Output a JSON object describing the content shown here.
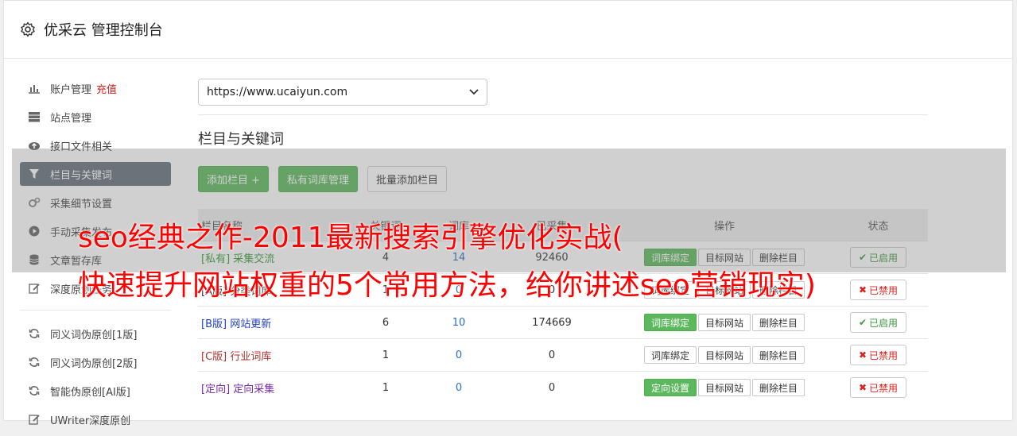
{
  "header": {
    "title": "优采云 管理控制台"
  },
  "sidebar": {
    "items": [
      {
        "label": "账户管理",
        "badge": "充值",
        "icon": "bar-chart-icon"
      },
      {
        "label": "站点管理",
        "icon": "server-icon"
      },
      {
        "label": "接口文件相关",
        "icon": "cloud-upload-icon"
      },
      {
        "label": "栏目与关键词",
        "icon": "filter-icon",
        "active": true
      },
      {
        "label": "采集细节设置",
        "icon": "gears-icon"
      },
      {
        "label": "手动采集发布",
        "icon": "play-circle-icon"
      },
      {
        "label": "文章暂存库",
        "icon": "database-icon"
      },
      {
        "label": "深度原创任务",
        "icon": "edit-icon"
      }
    ],
    "items2": [
      {
        "label": "同义词伪原创[1版]",
        "icon": "refresh-icon"
      },
      {
        "label": "同义词伪原创[2版]",
        "icon": "refresh-icon"
      },
      {
        "label": "智能伪原创[AI版]",
        "icon": "refresh-icon"
      },
      {
        "label": "UWriter深度原创",
        "icon": "edit-icon"
      }
    ]
  },
  "main": {
    "site_select": "https://www.ucaiyun.com",
    "section_title": "栏目与关键词",
    "buttons": {
      "add_column": "添加栏目 +",
      "private_lib": "私有词库管理",
      "batch_add": "批量添加栏目"
    },
    "table": {
      "headers": [
        "栏目名称",
        "关键词",
        "词库",
        "已采集",
        "操作",
        "状态"
      ],
      "rows": [
        {
          "tag": "[私有]",
          "name": "采集交流",
          "kw": "4",
          "lib": "14",
          "collected": "92460",
          "op1": "词库绑定",
          "op1_green": true,
          "op2": "目标网站",
          "op3": "删除栏目",
          "status": "已启用",
          "on": true,
          "tag_color": "#3a9a3a"
        },
        {
          "tag": "[A版]",
          "name": "分类词库",
          "kw": "1",
          "lib": "0",
          "collected": "0",
          "op1": "词库绑定",
          "op1_green": false,
          "op2": "目标网站",
          "op3": "删除栏目",
          "status": "已禁用",
          "on": false,
          "tag_color": "#333333"
        },
        {
          "tag": "[B版]",
          "name": "网站更新",
          "kw": "6",
          "lib": "10",
          "collected": "174669",
          "op1": "词库绑定",
          "op1_green": true,
          "op2": "目标网站",
          "op3": "删除栏目",
          "status": "已启用",
          "on": true,
          "tag_color": "#1f3fbf"
        },
        {
          "tag": "[C版]",
          "name": "行业词库",
          "kw": "1",
          "lib": "0",
          "collected": "0",
          "op1": "词库绑定",
          "op1_green": false,
          "op2": "目标网站",
          "op3": "删除栏目",
          "status": "已禁用",
          "on": false,
          "tag_color": "#b03030"
        },
        {
          "tag": "[定向]",
          "name": "定向采集",
          "kw": "1",
          "lib": "0",
          "collected": "0",
          "op1": "定向设置",
          "op1_green": true,
          "op2": "目标网站",
          "op3": "删除栏目",
          "status": "已禁用",
          "on": false,
          "tag_color": "#7a2aa8"
        }
      ]
    }
  },
  "watermark": {
    "line1": "seo经典之作-2011最新搜索引擎优化实战(",
    "line2": "快速提升网站权重的5个常用方法，给你讲述seo营销现实)"
  }
}
